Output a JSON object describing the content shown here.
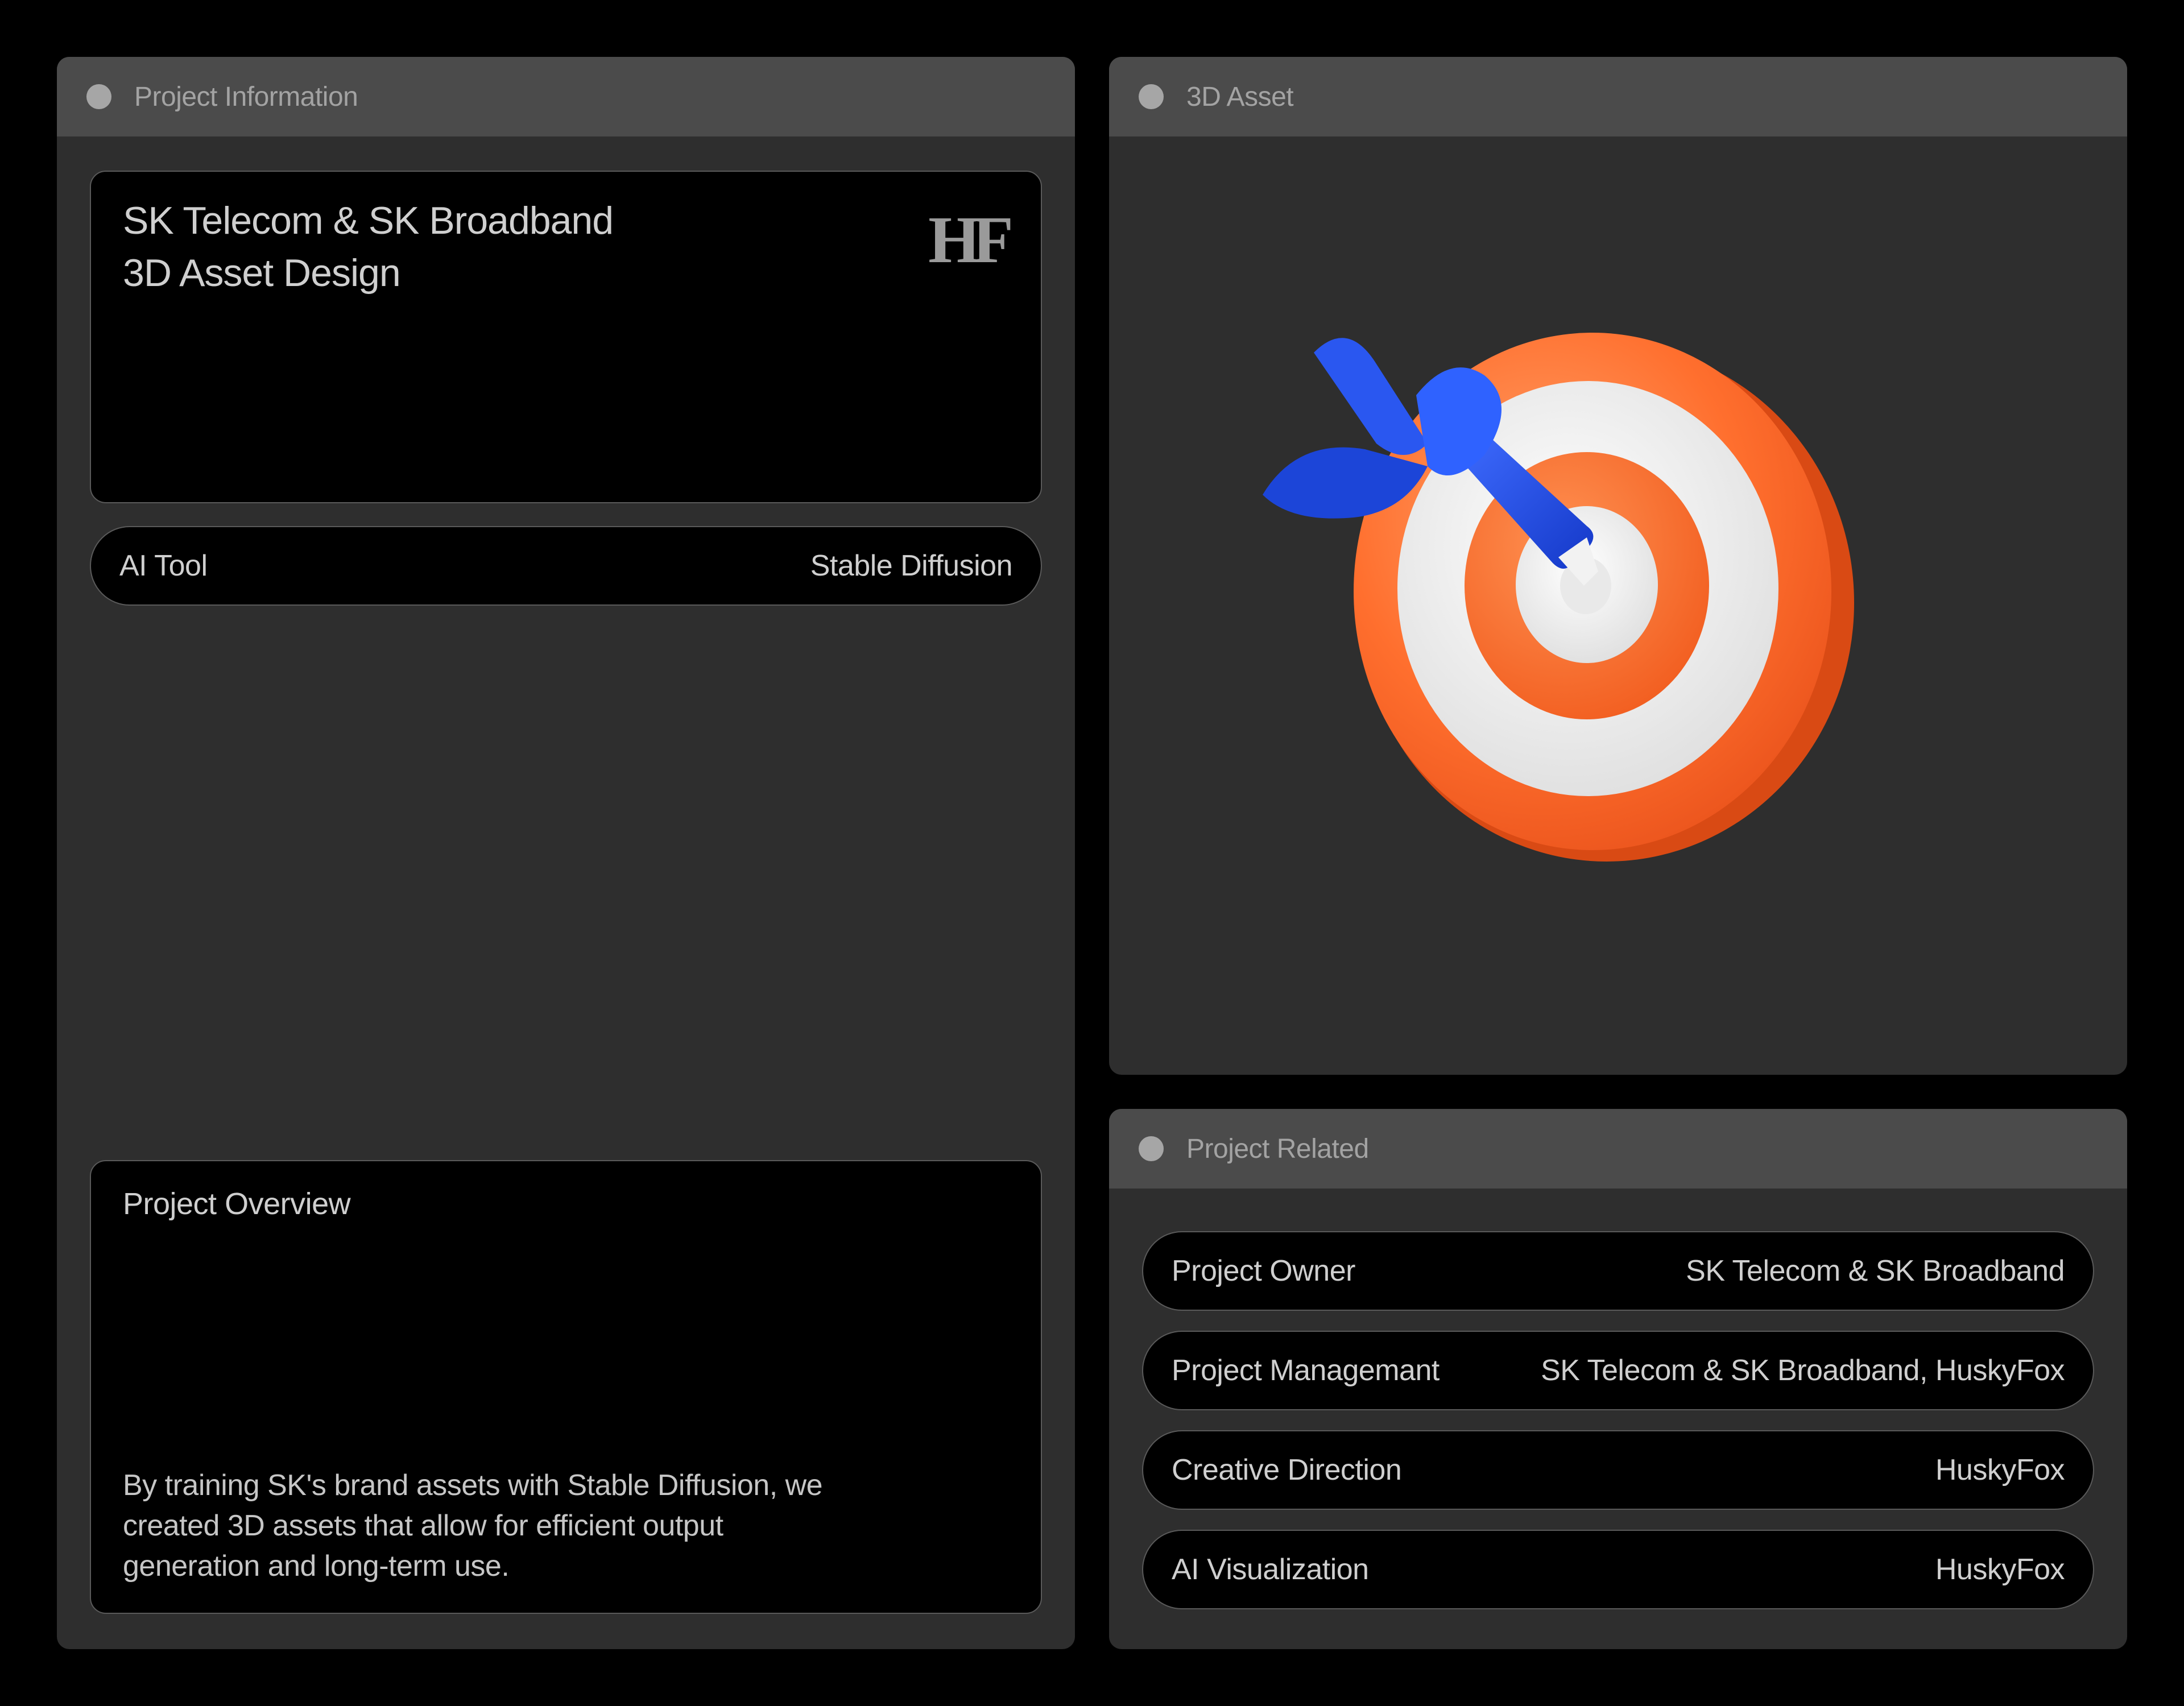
{
  "project_info_panel": {
    "title": "Project Information",
    "project_title_line1": "SK Telecom & SK Broadband",
    "project_title_line2": "3D Asset Design",
    "logo_text": "HF",
    "ai_tool": {
      "label": "AI Tool",
      "value": "Stable Diffusion"
    },
    "overview": {
      "label": "Project Overview",
      "text": "By training SK's brand assets with Stable Diffusion, we created 3D assets that allow for efficient output generation and long-term use."
    }
  },
  "asset_panel": {
    "title": "3D Asset",
    "image_subject": "dart-target-3d-icon",
    "colors": {
      "target_orange": "#ff6a2a",
      "target_white": "#f3f3f3",
      "dart_blue": "#1f4fe0"
    }
  },
  "related_panel": {
    "title": "Project Related",
    "rows": [
      {
        "label": "Project Owner",
        "value": "SK Telecom & SK Broadband"
      },
      {
        "label": "Project Managemant",
        "value": "SK Telecom & SK Broadband, HuskyFox"
      },
      {
        "label": "Creative Direction",
        "value": "HuskyFox"
      },
      {
        "label": "AI Visualization",
        "value": "HuskyFox"
      }
    ]
  },
  "theme": {
    "background": "#000000",
    "panel": "#2e2e2e",
    "panel_header": "#4b4b4b"
  }
}
